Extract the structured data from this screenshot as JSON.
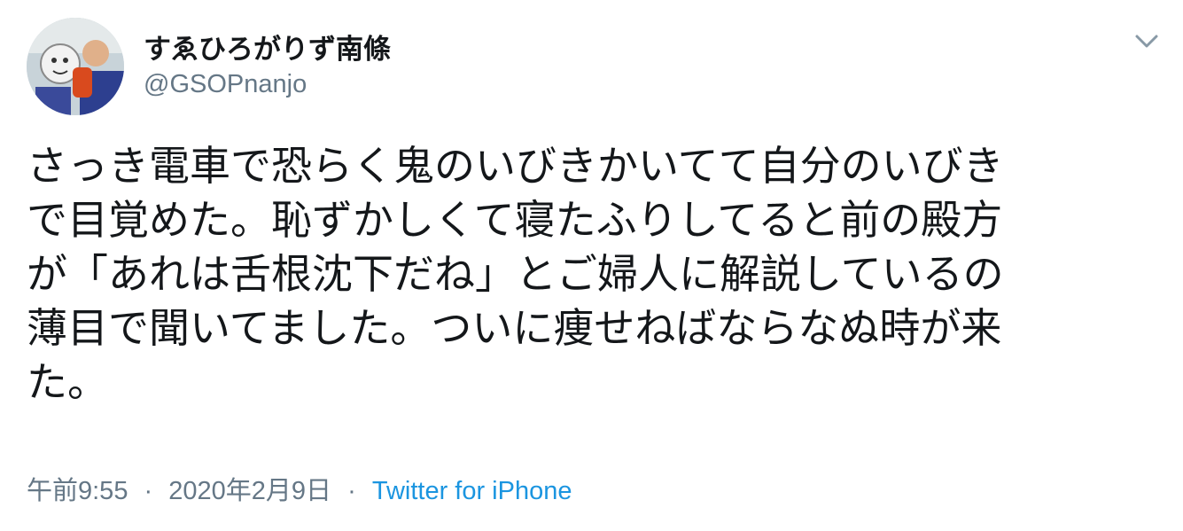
{
  "tweet": {
    "author": {
      "display_name": "すゑひろがりず南條",
      "handle": "@GSOPnanjo",
      "avatar_icon": "user-avatar-photo"
    },
    "menu_icon": "chevron-down-icon",
    "text_lines": [
      "さっき電車で恐らく鬼のいびきかいてて自分のいびき",
      "で目覚めた。恥ずかしくて寝たふりしてると前の殿方",
      "が「あれは舌根沈下だね」とご婦人に解説しているの",
      "薄目で聞いてました。ついに痩せねばならなぬ時が来",
      "た。"
    ],
    "meta": {
      "time": "午前9:55",
      "separator": "·",
      "date": "2020年2月9日",
      "source": "Twitter for iPhone"
    }
  },
  "colors": {
    "text": "#14171a",
    "secondary": "#657786",
    "link": "#1b95e0"
  }
}
